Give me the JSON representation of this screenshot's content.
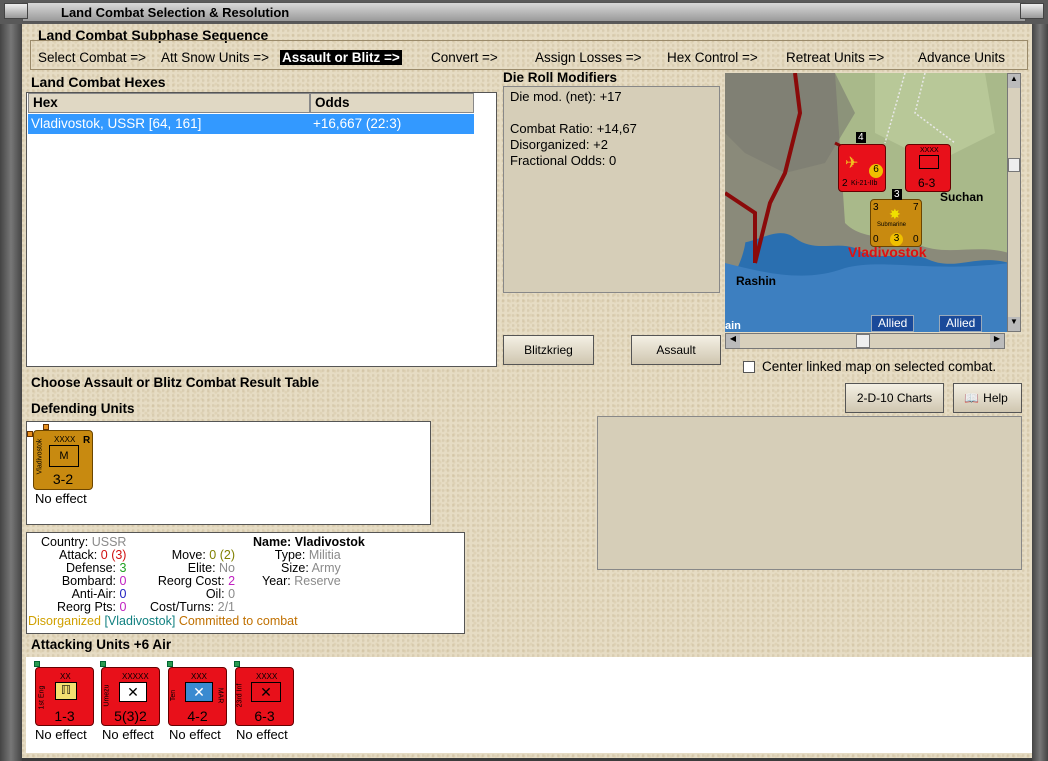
{
  "window": {
    "title": "Land Combat Selection & Resolution"
  },
  "sequence": {
    "title": "Land Combat Subphase Sequence",
    "phases": [
      "Select Combat =>",
      "Att Snow Units =>",
      "Assault or Blitz =>",
      "Convert =>",
      "Assign Losses =>",
      "Hex Control =>",
      "Retreat Units =>",
      "Advance Units"
    ],
    "selected_index": 2
  },
  "hexes": {
    "title": "Land Combat Hexes",
    "columns": [
      "Hex",
      "Odds"
    ],
    "rows": [
      {
        "hex": "Vladivostok, USSR [64, 161]",
        "odds": "+16,667 (22:3)"
      }
    ]
  },
  "modifiers": {
    "title": "Die Roll Modifiers",
    "net": "Die mod. (net): +17",
    "lines": [
      "Combat Ratio: +14,67",
      "Disorganized: +2",
      "Fractional Odds: 0"
    ]
  },
  "buttons": {
    "blitz": "Blitzkrieg",
    "assault": "Assault",
    "charts": "2-D-10 Charts",
    "help": "Help"
  },
  "map": {
    "labels": {
      "city": "Vladivostok",
      "town1": "Suchan",
      "town2": "Rashin",
      "edge": "ain"
    },
    "allied": [
      "Allied",
      "Allied"
    ],
    "units": [
      {
        "nums": "2",
        "sub": "Ki-21-IIb",
        "val": "6",
        "stack": "4"
      },
      {
        "top": "XXXX",
        "val": "6-3"
      },
      {
        "name": "Submarine",
        "left": "3",
        "right": "7",
        "bl": "0",
        "br": "0",
        "mid": "3",
        "stack": "3"
      }
    ]
  },
  "center_linked": "Center linked map on selected combat.",
  "result_title": "Choose Assault or Blitz Combat Result Table",
  "defending": {
    "title": "Defending Units",
    "units": [
      {
        "corner": "XXXX",
        "tag": "R",
        "side": "Vladivostok",
        "type": "M",
        "value": "3-2",
        "status": "No effect"
      }
    ]
  },
  "unit_info": {
    "country_l": "Country:",
    "country": "USSR",
    "attack_l": "Attack:",
    "attack": "0",
    "attack_b": "(3)",
    "defense_l": "Defense:",
    "defense": "3",
    "bombard_l": "Bombard:",
    "bombard": "0",
    "aa_l": "Anti-Air:",
    "aa": "0",
    "reorg_l": "Reorg Pts:",
    "reorg": "0",
    "name_l": "Name:",
    "name": "Vladivostok",
    "move_l": "Move:",
    "move": "0",
    "move_b": "(2)",
    "elite_l": "Elite:",
    "elite": "No",
    "reorgcost_l": "Reorg Cost:",
    "reorgcost": "2",
    "oil_l": "Oil:",
    "oil": "0",
    "costturns_l": "Cost/Turns:",
    "costturns": "2/1",
    "type_l": "Type:",
    "type": "Militia",
    "size_l": "Size:",
    "size": "Army",
    "year_l": "Year:",
    "year": "Reserve",
    "status1": "Disorganized",
    "status2": "[Vladivostok]",
    "status3": "Committed to combat"
  },
  "attacking": {
    "title": "Attacking Units +6 Air",
    "units": [
      {
        "top": "XX",
        "side": "1st Eng",
        "value": "1-3",
        "status": "No effect"
      },
      {
        "top": "XXXXX",
        "side": "Umezu",
        "value": "5(3)2",
        "status": "No effect"
      },
      {
        "top": "XXX",
        "side": "Ten",
        "side2": "MAR",
        "value": "4-2",
        "status": "No effect"
      },
      {
        "top": "XXXX",
        "side": "23rd Inf",
        "value": "6-3",
        "status": "No effect"
      }
    ]
  },
  "colors": {
    "counter_red": "#e8101a",
    "counter_gold": "#c88a10",
    "selection": "#3399ff"
  }
}
